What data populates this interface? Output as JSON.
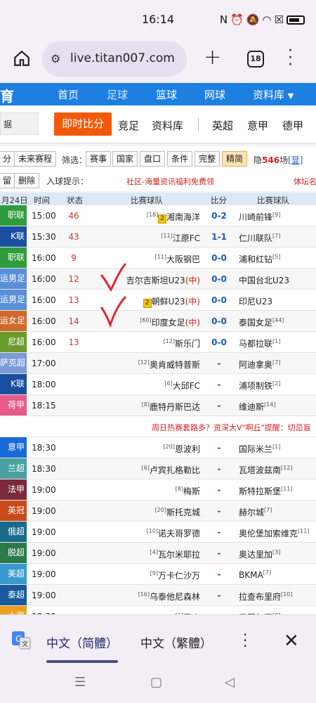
{
  "status": {
    "time": "16:14"
  },
  "browser": {
    "url": "live.titan007.com",
    "tab_count": "18"
  },
  "sitenav": {
    "brand": "育",
    "items": [
      "首页",
      "足球",
      "篮球",
      "网球",
      "资料库"
    ],
    "active": "足球"
  },
  "subnav": {
    "side": "据",
    "live": "即时比分",
    "links": [
      "竞足",
      "资料库",
      "英超",
      "意甲",
      "德甲"
    ]
  },
  "filter": {
    "btn_fen": "分",
    "future": "未来赛程",
    "filter_label": "筛选：",
    "buttons": [
      "赛事",
      "国家",
      "盘口",
      "条件",
      "完整",
      "精简"
    ],
    "hidden_prefix": "隐",
    "hidden_count": "546",
    "hidden_suffix": "场",
    "show": "[显]",
    "keep": "留",
    "delete": "删除",
    "goal_hint": "入球提示：",
    "banner": "社区-海量资讯福利免费领",
    "banner_right": "体坛名"
  },
  "table": {
    "headers": {
      "date": "月24日",
      "time": "时间",
      "status": "状态",
      "home": "比赛球队",
      "score": "比分",
      "away": "比赛球队"
    },
    "rows": [
      {
        "league": "职联",
        "color": "#2e9c3a",
        "time": "15:00",
        "status": "46",
        "home_rank": "[18]",
        "home_card": "2",
        "home": "湘南海洋",
        "home_suffix": "",
        "score": "0-2",
        "away": "川崎前锋",
        "away_rank": "[9]"
      },
      {
        "league": "K联",
        "color": "#1a4fa0",
        "time": "15:30",
        "status": "43",
        "home_rank": "[11]",
        "home_card": "",
        "home": "江原FC",
        "home_suffix": "",
        "score": "1-1",
        "away": "仁川联队",
        "away_rank": "[7]"
      },
      {
        "league": "职联",
        "color": "#2e9c3a",
        "time": "16:00",
        "status": "9",
        "home_rank": "[11]",
        "home_card": "",
        "home": "大阪钢巴",
        "home_suffix": "",
        "score": "0-0",
        "away": "浦和红钻",
        "away_rank": "[5]"
      },
      {
        "league": "运男足",
        "color": "#5a8fd8",
        "time": "16:00",
        "status": "12",
        "home_rank": "",
        "home_card": "",
        "home": "吉尔吉斯坦U23",
        "home_suffix": "(中)",
        "score": "0-0",
        "away": "中国台北U23",
        "away_rank": ""
      },
      {
        "league": "运男足",
        "color": "#5a8fd8",
        "time": "16:00",
        "status": "13",
        "home_rank": "",
        "home_card": "2",
        "home": "朝鲜U23",
        "home_suffix": "(中)",
        "score": "0-0",
        "away": "印尼U23",
        "away_rank": ""
      },
      {
        "league": "运女足",
        "color": "#d06a2a",
        "time": "16:00",
        "status": "14",
        "home_rank": "[60]",
        "home_card": "",
        "home": "印度女足",
        "home_suffix": "(中)",
        "score": "0-0",
        "away": "泰国女足",
        "away_rank": "[44]"
      },
      {
        "league": "尼超",
        "color": "#6a9a2a",
        "time": "16:00",
        "status": "13",
        "home_rank": "[12]",
        "home_card": "",
        "home": "斯乐门",
        "home_suffix": "",
        "score": "0-0",
        "away": "马都拉联",
        "away_rank": "[1]"
      },
      {
        "league": "萨克超",
        "color": "#7a9ad8",
        "time": "17:00",
        "status": "",
        "home_rank": "[12]",
        "home_card": "",
        "home": "奥肯威特普斯",
        "home_suffix": "",
        "score": "-",
        "away": "阿迪拿奥",
        "away_rank": "[7]"
      },
      {
        "league": "K联",
        "color": "#1a4fa0",
        "time": "18:00",
        "status": "",
        "home_rank": "[6]",
        "home_card": "",
        "home": "大邱FC",
        "home_suffix": "",
        "score": "-",
        "away": "浦项制铁",
        "away_rank": "[2]"
      },
      {
        "league": "荷甲",
        "color": "#e85a8a",
        "time": "18:15",
        "status": "",
        "home_rank": "[8]",
        "home_card": "",
        "home": "鹿特丹斯巴达",
        "home_suffix": "",
        "score": "-",
        "away": "维迪斯",
        "away_rank": "[14]"
      }
    ],
    "mid_banner": "周日热赛套路多？资深大V\"啊丘\"提醒：切忌盲",
    "rows2": [
      {
        "league": "意甲",
        "color": "#1a6ad8",
        "time": "18:30",
        "status": "",
        "home_rank": "[20]",
        "home_card": "",
        "home": "恩波利",
        "home_suffix": "",
        "score": "-",
        "away": "国际米兰",
        "away_rank": "[1]"
      },
      {
        "league": "兰超",
        "color": "#4aa0a0",
        "time": "18:30",
        "status": "",
        "home_rank": "[6]",
        "home_card": "",
        "home": "卢宾扎格勒比",
        "home_suffix": "",
        "score": "-",
        "away": "瓦塔波兹南",
        "away_rank": "[12]"
      },
      {
        "league": "法甲",
        "color": "#7a2a3a",
        "time": "19:00",
        "status": "",
        "home_rank": "[8]",
        "home_card": "",
        "home": "梅斯",
        "home_suffix": "",
        "score": "-",
        "away": "斯特拉斯堡",
        "away_rank": "[11]"
      },
      {
        "league": "英冠",
        "color": "#c84a1a",
        "time": "19:00",
        "status": "",
        "home_rank": "[20]",
        "home_card": "",
        "home": "斯托克城",
        "home_suffix": "",
        "score": "-",
        "away": "赫尔城",
        "away_rank": "[7]"
      },
      {
        "league": "俄超",
        "color": "#1a6a8a",
        "time": "19:00",
        "status": "",
        "home_rank": "[10]",
        "home_card": "",
        "home": "诺夫哥罗德",
        "home_suffix": "",
        "score": "-",
        "away": "奥伦堡加索维克",
        "away_rank": "[11]"
      },
      {
        "league": "脱超",
        "color": "#2a7a4a",
        "time": "19:00",
        "status": "",
        "home_rank": "[4]",
        "home_card": "",
        "home": "瓦尔米耶拉",
        "home_suffix": "",
        "score": "-",
        "away": "奥达里加",
        "away_rank": "[3]"
      },
      {
        "league": "美超",
        "color": "#3a9ad0",
        "time": "19:00",
        "status": "",
        "home_rank": "[9]",
        "home_card": "",
        "home": "万卡仁沙万",
        "home_suffix": "",
        "score": "-",
        "away": "BKMA",
        "away_rank": "[7]"
      },
      {
        "league": "泰超",
        "color": "#1a5a9a",
        "time": "19:00",
        "status": "",
        "home_rank": "[16]",
        "home_card": "",
        "home": "乌泰他尼森林",
        "home_suffix": "",
        "score": "-",
        "away": "拉查布里府",
        "away_rank": "[10]"
      },
      {
        "league": "土甲",
        "color": "#e8a020",
        "time": "19:30",
        "status": "",
        "home_rank": "[6]",
        "home_card": "",
        "home": "喜克",
        "home_suffix": "",
        "score": "-",
        "away": "圣图尔赛",
        "away_rank": "[8]"
      }
    ]
  },
  "translate": {
    "lang_a": "中文（简體）",
    "lang_b": "中文（繁體）"
  }
}
